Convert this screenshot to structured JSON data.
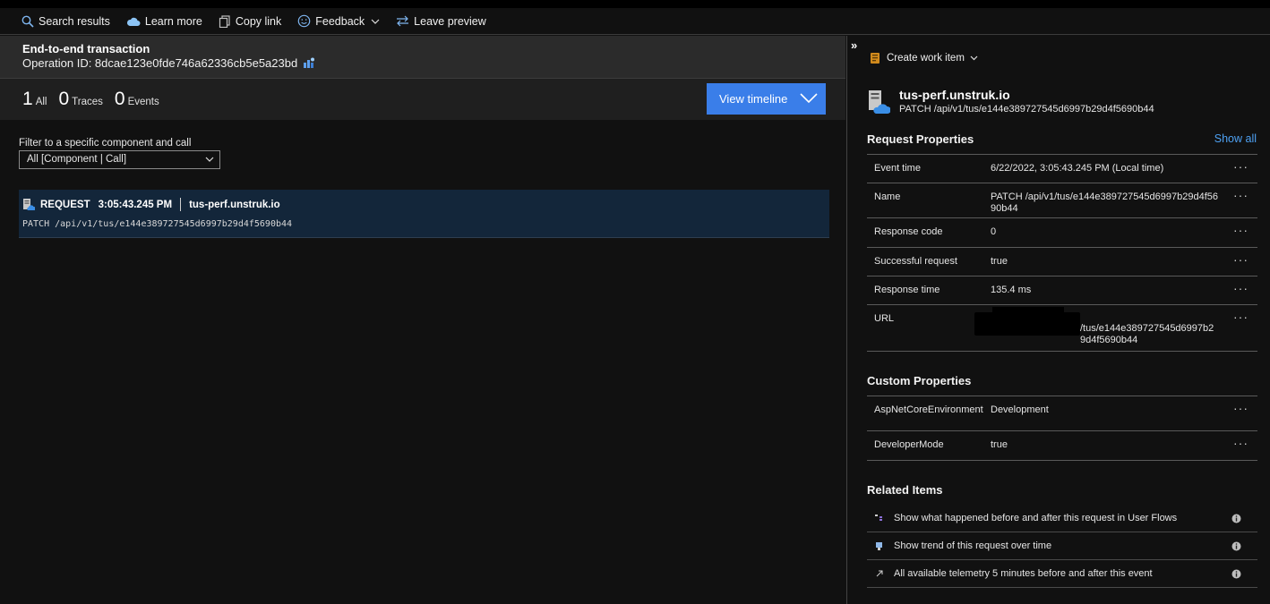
{
  "toolbar": {
    "search_results": "Search results",
    "learn_more": "Learn more",
    "copy_link": "Copy link",
    "feedback": "Feedback",
    "leave_preview": "Leave preview"
  },
  "transaction": {
    "title": "End-to-end transaction",
    "operation_id": "Operation ID: 8dcae123e0fde746a62336cb5e5a23bd"
  },
  "counts": [
    {
      "n": "1",
      "label": "All"
    },
    {
      "n": "0",
      "label": "Traces"
    },
    {
      "n": "0",
      "label": "Events"
    }
  ],
  "view_timeline": "View timeline",
  "filter": {
    "label": "Filter to a specific component and call",
    "value": "All [Component | Call]"
  },
  "request": {
    "type": "REQUEST",
    "time": "3:05:43.245 PM",
    "host": "tus-perf.unstruk.io",
    "path": "PATCH /api/v1/tus/e144e389727545d6997b29d4f5690b44"
  },
  "right": {
    "collapse": "»",
    "create_work_item": "Create work item",
    "resource_name": "tus-perf.unstruk.io",
    "resource_sub": "PATCH /api/v1/tus/e144e389727545d6997b29d4f5690b44",
    "request_properties_title": "Request Properties",
    "show_all": "Show all",
    "request_properties": [
      {
        "key": "Event time",
        "value": "6/22/2022, 3:05:43.245 PM (Local time)"
      },
      {
        "key": "Name",
        "value": "PATCH /api/v1/tus/e144e389727545d6997b29d4f5690b44"
      },
      {
        "key": "Response code",
        "value": "0"
      },
      {
        "key": "Successful request",
        "value": "true"
      },
      {
        "key": "Response time",
        "value": "135.4 ms"
      },
      {
        "key": "URL",
        "value": "/tus/e144e389727545d6997b29d4f5690b44"
      }
    ],
    "custom_properties_title": "Custom Properties",
    "custom_properties": [
      {
        "key": "AspNetCoreEnvironment",
        "value": "Development"
      },
      {
        "key": "DeveloperMode",
        "value": "true"
      }
    ],
    "related_items_title": "Related Items",
    "related_items": [
      "Show what happened before and after this request in User Flows",
      "Show trend of this request over time",
      "All available telemetry 5 minutes before and after this event"
    ],
    "dots": "···"
  }
}
